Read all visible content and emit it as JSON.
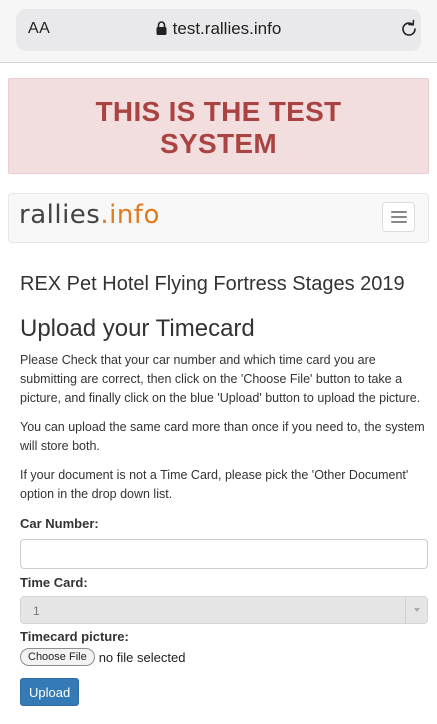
{
  "browser": {
    "text_size_label": "AA",
    "url": "test.rallies.info"
  },
  "banner": {
    "line1": "THIS IS THE TEST",
    "line2": "SYSTEM"
  },
  "navbar": {
    "brand_main": "rallies",
    "brand_suffix": ".info"
  },
  "page": {
    "event_title": "REX Pet Hotel Flying Fortress Stages 2019",
    "section_title": "Upload your Timecard",
    "paragraphs": [
      "Please Check that your car number and which time card you are submitting are correct, then click on the 'Choose File' button to take a picture, and finally click on the blue 'Upload' button to upload the picture.",
      "You can upload the same card more than once if you need to, the system will store both.",
      "If your document is not a Time Card, please pick the 'Other Document' option in the drop down list."
    ]
  },
  "form": {
    "car_number_label": "Car Number:",
    "car_number_value": "",
    "time_card_label": "Time Card:",
    "time_card_selected": "1",
    "timecard_picture_label": "Timecard picture:",
    "choose_file_label": "Choose File",
    "file_status": "no file selected",
    "upload_label": "Upload"
  },
  "colors": {
    "banner_text": "#a94442",
    "banner_bg": "#f2dede",
    "brand_accent": "#e07b1f",
    "upload_button": "#337ab7"
  }
}
